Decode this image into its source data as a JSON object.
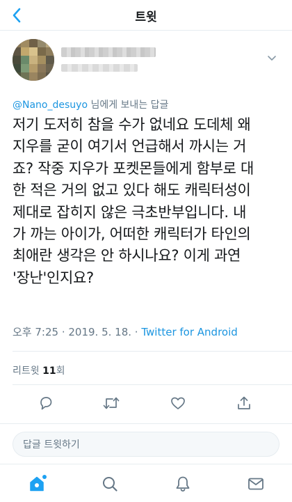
{
  "topbar": {
    "title": "트윗",
    "back_icon": "chevron-left-icon"
  },
  "tweet": {
    "replying_to": {
      "mention": "@Nano_desuyo",
      "suffix": " 님에게 보내는 답글"
    },
    "text": "저기 도저히 참을 수가 없네요 도데체 왜\n지우를 굳이 여기서 언급해서 까시는 거\n죠? 작중 지우가 포켓몬들에게 함부로 대\n한 적은 거의 없고 있다 해도 캐릭터성이\n제대로 잡히지 않은 극초반부입니다. 내\n가 까는 아이가, 어떠한 캐릭터가 타인의\n최애란 생각은 안 하시나요? 이게 과연\n'장난'인지요?",
    "time": "오후 7:25",
    "date": "2019. 5. 18.",
    "separator": " · ",
    "source": "Twitter for Android",
    "retweets_label": "리트윗 ",
    "retweets_count": "11",
    "retweets_unit": "회"
  },
  "actions": [
    "reply-icon",
    "retweet-icon",
    "like-icon",
    "share-icon"
  ],
  "reply_box": {
    "placeholder": "답글 트윗하기"
  },
  "tabbar": [
    "home-icon",
    "search-icon",
    "notifications-icon",
    "messages-icon"
  ],
  "colors": {
    "accent": "#1da1f2",
    "link": "#1b95e0",
    "muted": "#657786",
    "text": "#14171a",
    "border": "#e6ecf0"
  }
}
